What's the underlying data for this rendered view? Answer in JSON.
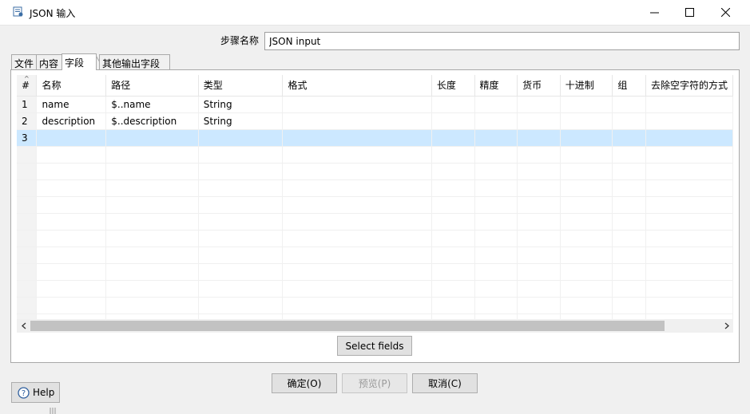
{
  "window": {
    "title": "JSON 输入",
    "minimize_glyph": "—",
    "maximize_glyph": "☐",
    "close_glyph": "✕"
  },
  "step": {
    "label": "步骤名称",
    "value": "JSON input"
  },
  "tabs": [
    {
      "label": "文件",
      "active": false
    },
    {
      "label": "内容",
      "active": false
    },
    {
      "label": "字段",
      "active": true
    },
    {
      "label": "其他输出字段",
      "active": false
    }
  ],
  "table": {
    "columns": [
      "#",
      "名称",
      "路径",
      "类型",
      "格式",
      "长度",
      "精度",
      "货币",
      "十进制",
      "组",
      "去除空字符的方式"
    ],
    "rows": [
      {
        "num": "1",
        "name": "name",
        "path": "$..name",
        "type": "String"
      },
      {
        "num": "2",
        "name": "description",
        "path": "$..description",
        "type": "String"
      },
      {
        "num": "3",
        "name": "",
        "path": "",
        "type": "",
        "selected": true
      }
    ]
  },
  "buttons": {
    "select_fields": "Select fields",
    "ok": "确定(O)",
    "preview": "预览(P)",
    "cancel": "取消(C)",
    "help": "Help"
  },
  "colors": {
    "selected_row": "#cce8ff",
    "panel_bg": "#ffffff",
    "dialog_bg": "#f0f0f0"
  }
}
